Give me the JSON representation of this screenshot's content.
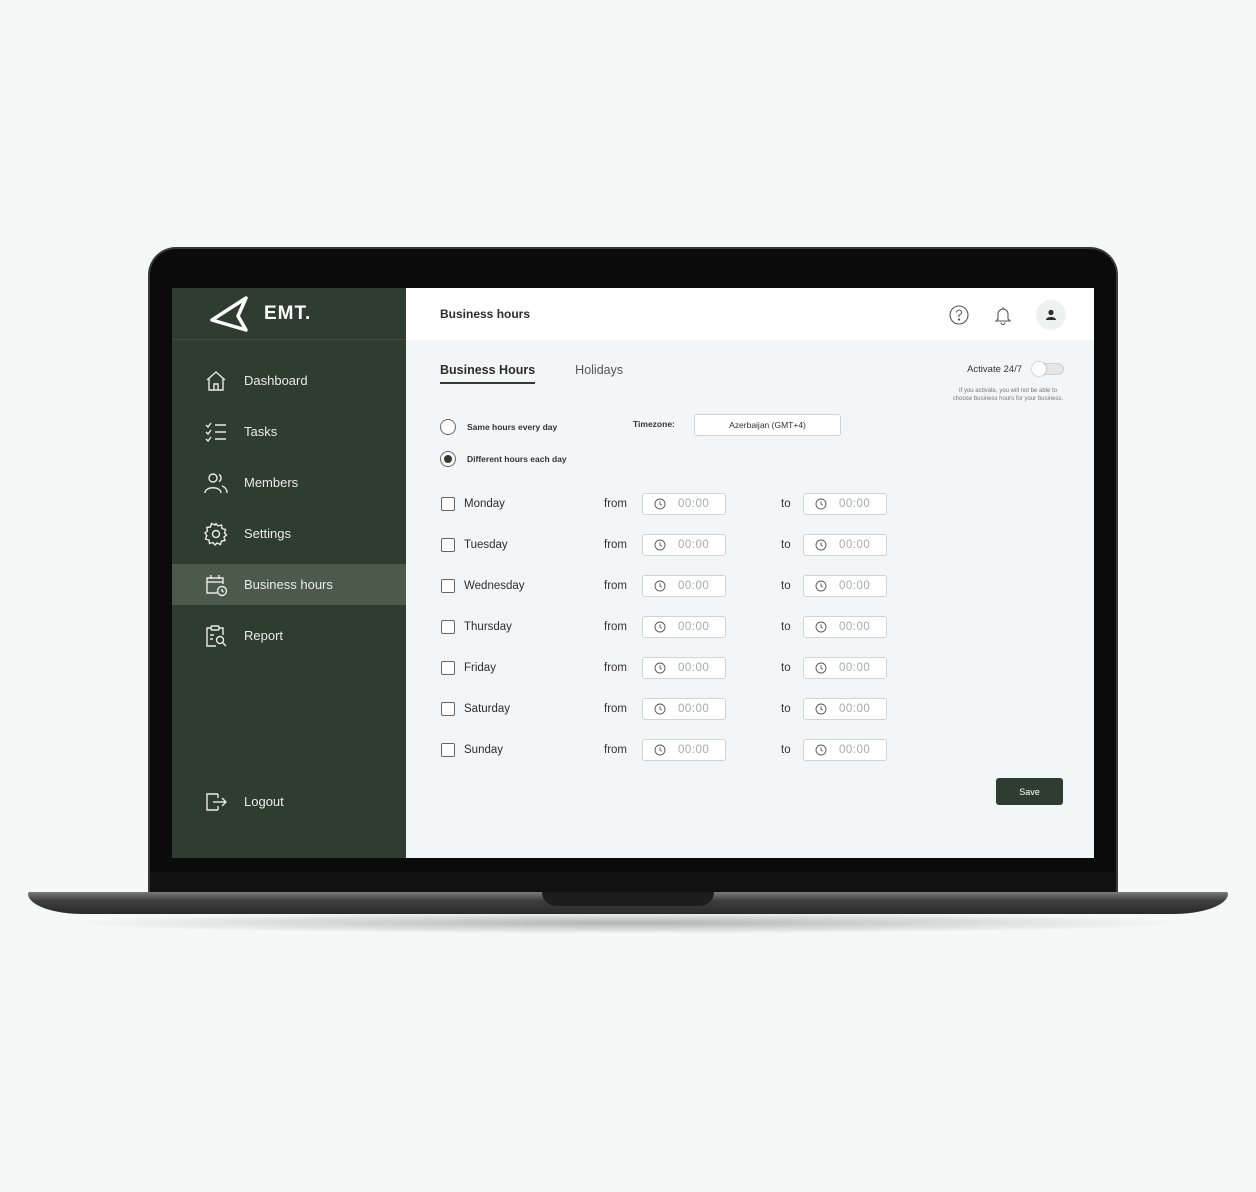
{
  "app": {
    "brand": "EMT."
  },
  "sidebar": {
    "items": [
      {
        "label": "Dashboard",
        "icon": "home-icon"
      },
      {
        "label": "Tasks",
        "icon": "checklist-icon"
      },
      {
        "label": "Members",
        "icon": "users-icon"
      },
      {
        "label": "Settings",
        "icon": "gear-icon"
      },
      {
        "label": "Business hours",
        "icon": "calendar-clock-icon",
        "active": true
      },
      {
        "label": "Report",
        "icon": "clipboard-search-icon"
      }
    ],
    "logout": "Logout"
  },
  "header": {
    "title": "Business hours",
    "icons": [
      "help-icon",
      "bell-icon",
      "user-icon"
    ]
  },
  "tabs": [
    {
      "label": "Business Hours",
      "active": true
    },
    {
      "label": "Holidays",
      "active": false
    }
  ],
  "activate": {
    "label": "Activate 24/7",
    "enabled": false,
    "note": "If you activate, you will not be able to choose business hours for your business."
  },
  "mode": {
    "same": "Same hours every day",
    "different": "Different hours each day",
    "selected": "different"
  },
  "timezone": {
    "label": "Timezone:",
    "value": "Azerbaijan (GMT+4)"
  },
  "days": [
    {
      "name": "Monday",
      "from_label": "from",
      "from": "00:00",
      "to_label": "to",
      "to": "00:00"
    },
    {
      "name": "Tuesday",
      "from_label": "from",
      "from": "00:00",
      "to_label": "to",
      "to": "00:00"
    },
    {
      "name": "Wednesday",
      "from_label": "from",
      "from": "00:00",
      "to_label": "to",
      "to": "00:00"
    },
    {
      "name": "Thursday",
      "from_label": "from",
      "from": "00:00",
      "to_label": "to",
      "to": "00:00"
    },
    {
      "name": "Friday",
      "from_label": "from",
      "from": "00:00",
      "to_label": "to",
      "to": "00:00"
    },
    {
      "name": "Saturday",
      "from_label": "from",
      "from": "00:00",
      "to_label": "to",
      "to": "00:00"
    },
    {
      "name": "Sunday",
      "from_label": "from",
      "from": "00:00",
      "to_label": "to",
      "to": "00:00"
    }
  ],
  "actions": {
    "save": "Save"
  },
  "colors": {
    "sidebar": "#2f3c30",
    "active_item": "#4b5a4b",
    "accent": "#2f3c30"
  }
}
